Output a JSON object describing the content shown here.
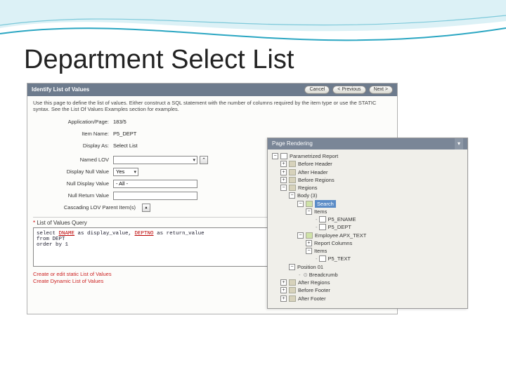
{
  "slide": {
    "title": "Department Select List"
  },
  "panel": {
    "title": "Identify List of Values",
    "buttons": {
      "cancel": "Cancel",
      "prev": "< Previous",
      "next": "Next >"
    },
    "desc": "Use this page to define the list of values. Either construct a SQL statement with the number of columns required by the item type or use the STATIC syntax. See the List Of Values Examples section for examples.",
    "fields": {
      "app_label": "Application/Page:",
      "app_val": "183/5",
      "item_label": "Item Name:",
      "item_val": "P5_DEPT",
      "display_label": "Display As:",
      "display_val": "Select List",
      "named_label": "Named LOV",
      "named_val": "",
      "null_label": "Display Null Value",
      "null_val": "Yes",
      "nulldisp_label": "Null Display Value",
      "nulldisp_val": "- All -",
      "nullret_label": "Null Return Value",
      "nullret_val": "",
      "cascade_label": "Cascading LOV Parent Item(s)"
    },
    "lov_header": "List of Values Query",
    "sql_line1a": "select ",
    "sql_line1b": "DNAME",
    "sql_line1c": " as display_value, ",
    "sql_line1d": "DEPTNO",
    "sql_line1e": " as return_value",
    "sql_line2": "from DEPT",
    "sql_line3": "order by 1",
    "links": {
      "static": "Create or edit static List of Values",
      "dynamic": "Create Dynamic List of Values"
    }
  },
  "side": {
    "title": "Page Rendering",
    "tree": {
      "root": "Parametrized Report",
      "before_hdr": "Before Header",
      "after_hdr": "After Header",
      "before_reg": "Before Regions",
      "regions": "Regions",
      "body": "Body (3)",
      "search": "Search",
      "items": "Items",
      "p5_ename": "P5_ENAME",
      "p5_dept": "P5_DEPT",
      "emp_apx": "Employee APX_TEXT",
      "rep_cols": "Report Columns",
      "items2": "Items",
      "p5_text": "P5_TEXT",
      "pos01": "Position 01",
      "breadcrumb": "Breadcrumb",
      "after_reg": "After Regions",
      "before_ftr": "Before Footer",
      "after_ftr": "After Footer"
    }
  }
}
